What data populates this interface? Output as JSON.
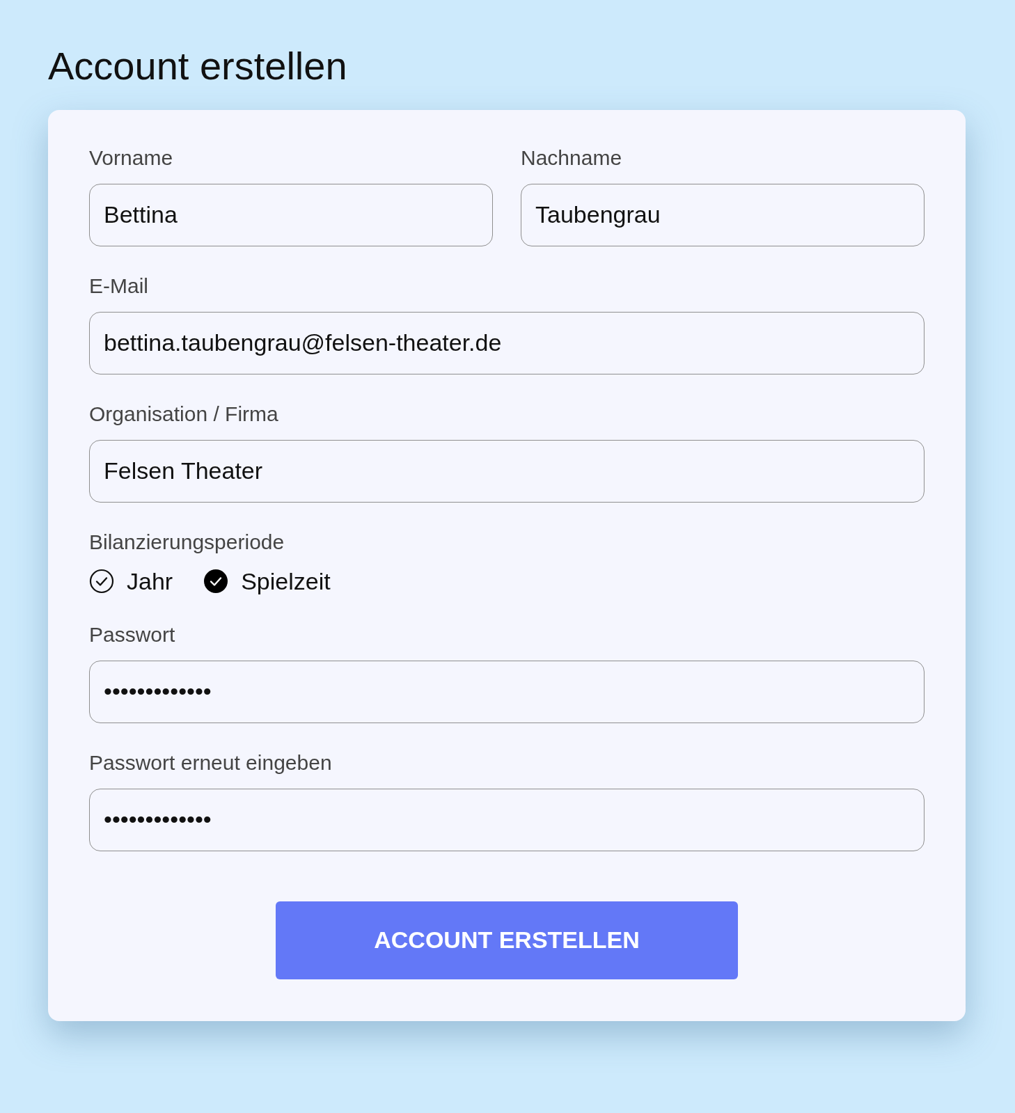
{
  "title": "Account erstellen",
  "name_row": [
    {
      "label": "Vorname",
      "value": "Bettina"
    },
    {
      "label": "Nachname",
      "value": "Taubengrau"
    }
  ],
  "email": {
    "label": "E-Mail",
    "value": "bettina.taubengrau@felsen-theater.de"
  },
  "organisation": {
    "label": "Organisation / Firma",
    "value": "Felsen Theater"
  },
  "period": {
    "label": "Bilanzierungsperiode",
    "options": [
      {
        "label": "Jahr",
        "selected": false
      },
      {
        "label": "Spielzeit",
        "selected": true
      }
    ]
  },
  "password": {
    "label": "Passwort",
    "value": "•••••••••••••"
  },
  "password_repeat": {
    "label": "Passwort erneut eingeben",
    "value": "•••••••••••••"
  },
  "submit": {
    "label": "ACCOUNT ERSTELLEN"
  }
}
